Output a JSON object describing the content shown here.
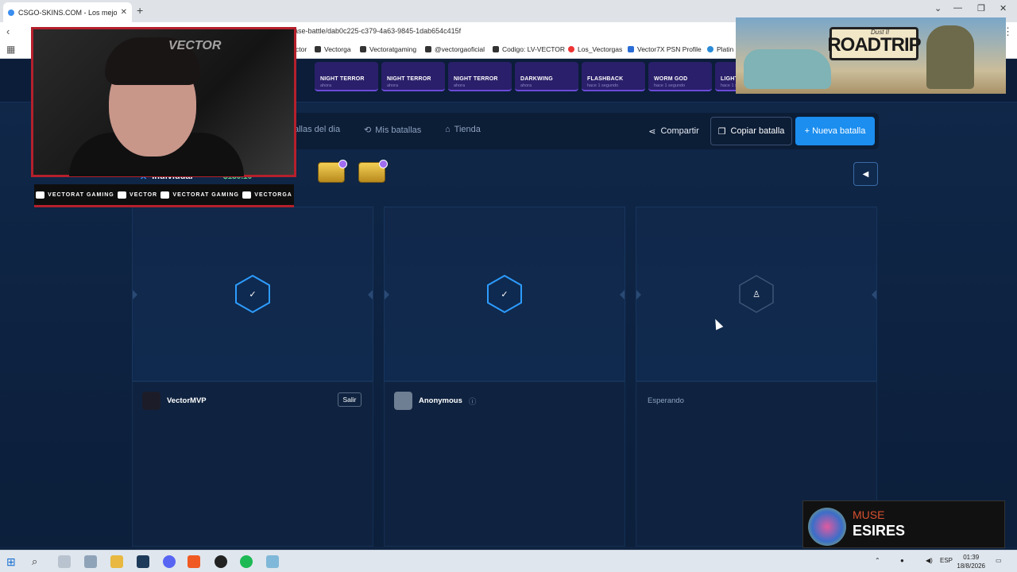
{
  "browser": {
    "tab_title": "CSGO-SKINS.COM - Los mejores",
    "url": "ase-battle/dab0c225-c379-4a63-9845-1dab654c415f",
    "bookmarks": [
      "ctor",
      "Vectorga",
      "Vectoratgaming",
      "@vectorgaoficial",
      "Codigo: LV-VECTOR",
      "Los_Vectorgas",
      "Vector7X PSN Profile",
      "Platin"
    ]
  },
  "ticker": [
    {
      "name": "NIGHT TERROR",
      "sub": "ahora"
    },
    {
      "name": "NIGHT TERROR",
      "sub": "ahora"
    },
    {
      "name": "NIGHT TERROR",
      "sub": "ahora"
    },
    {
      "name": "DARKWING",
      "sub": "ahora"
    },
    {
      "name": "FLASHBACK",
      "sub": "hace 1 segundo"
    },
    {
      "name": "WORM GOD",
      "sub": "hace 1 segundo"
    },
    {
      "name": "LIGHT",
      "sub": "hace 1 s"
    }
  ],
  "nav": {
    "battles_day": "allas del dia",
    "my_battles": "Mis batallas",
    "store": "Tienda",
    "share": "Compartir",
    "copy": "Copiar batalla",
    "new": "+ Nueva batalla"
  },
  "battle": {
    "mode": "Individual",
    "price": "$130.10"
  },
  "players": [
    {
      "name": "VectorMVP",
      "action": "Salir"
    },
    {
      "name": "Anonymous"
    },
    {
      "name": "Esperando"
    }
  ],
  "overlay": {
    "watermark": "VECTOR",
    "socials": [
      "VECTORAT GAMING",
      "VECTOR",
      "VECTORAT GAMING",
      "VECTORGA"
    ],
    "ad_title": "ROADTRIP",
    "ad_sub": "Dust II",
    "music_artist": "MUSE",
    "music_song": "ESIRES"
  },
  "taskbar": {
    "lang": "ESP",
    "time": "01:39",
    "date": "18/8/2026"
  },
  "colors": {
    "accent": "#1b8ef0",
    "background": "#0f2441",
    "overlay_border": "#b5202c"
  }
}
